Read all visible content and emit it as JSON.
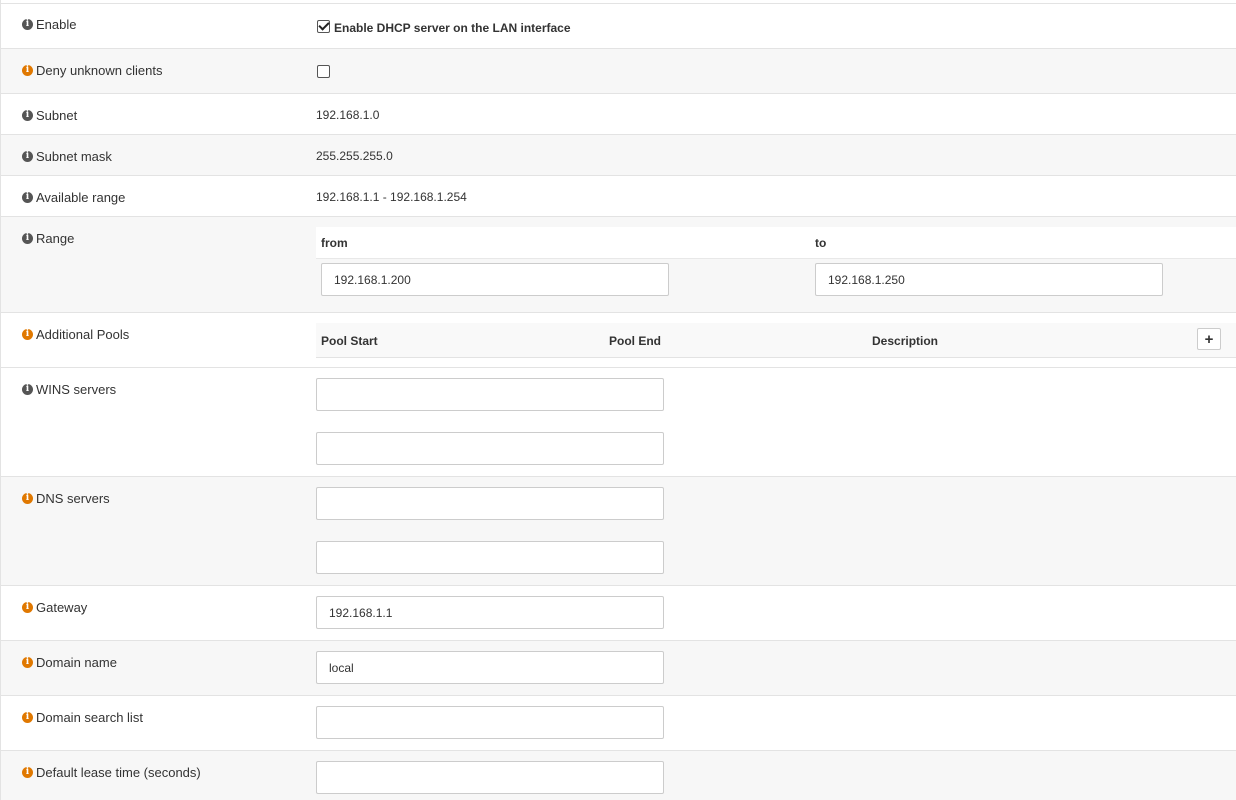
{
  "fields": {
    "enable": {
      "label": "Enable",
      "checkbox_label": "Enable DHCP server on the LAN interface",
      "checked": true
    },
    "deny_unknown": {
      "label": "Deny unknown clients",
      "checked": false
    },
    "subnet": {
      "label": "Subnet",
      "value": "192.168.1.0"
    },
    "subnet_mask": {
      "label": "Subnet mask",
      "value": "255.255.255.0"
    },
    "available_range": {
      "label": "Available range",
      "value": "192.168.1.1 - 192.168.1.254"
    },
    "range": {
      "label": "Range",
      "from_label": "from",
      "to_label": "to",
      "from_value": "192.168.1.200",
      "to_value": "192.168.1.250"
    },
    "additional_pools": {
      "label": "Additional Pools",
      "columns": [
        "Pool Start",
        "Pool End",
        "Description"
      ],
      "add_icon": "plus-icon"
    },
    "wins_servers": {
      "label": "WINS servers",
      "values": [
        "",
        ""
      ]
    },
    "dns_servers": {
      "label": "DNS servers",
      "values": [
        "",
        ""
      ]
    },
    "gateway": {
      "label": "Gateway",
      "value": "192.168.1.1"
    },
    "domain_name": {
      "label": "Domain name",
      "value": "local"
    },
    "domain_search_list": {
      "label": "Domain search list",
      "value": ""
    },
    "default_lease_time": {
      "label": "Default lease time (seconds)",
      "value": ""
    }
  },
  "icons": {
    "info": "info-circle-icon",
    "info_char": "i"
  },
  "colors": {
    "info_grey": "#555555",
    "info_orange": "#e07800",
    "row_alt": "#f7f7f7",
    "border": "#e3e3e3"
  }
}
